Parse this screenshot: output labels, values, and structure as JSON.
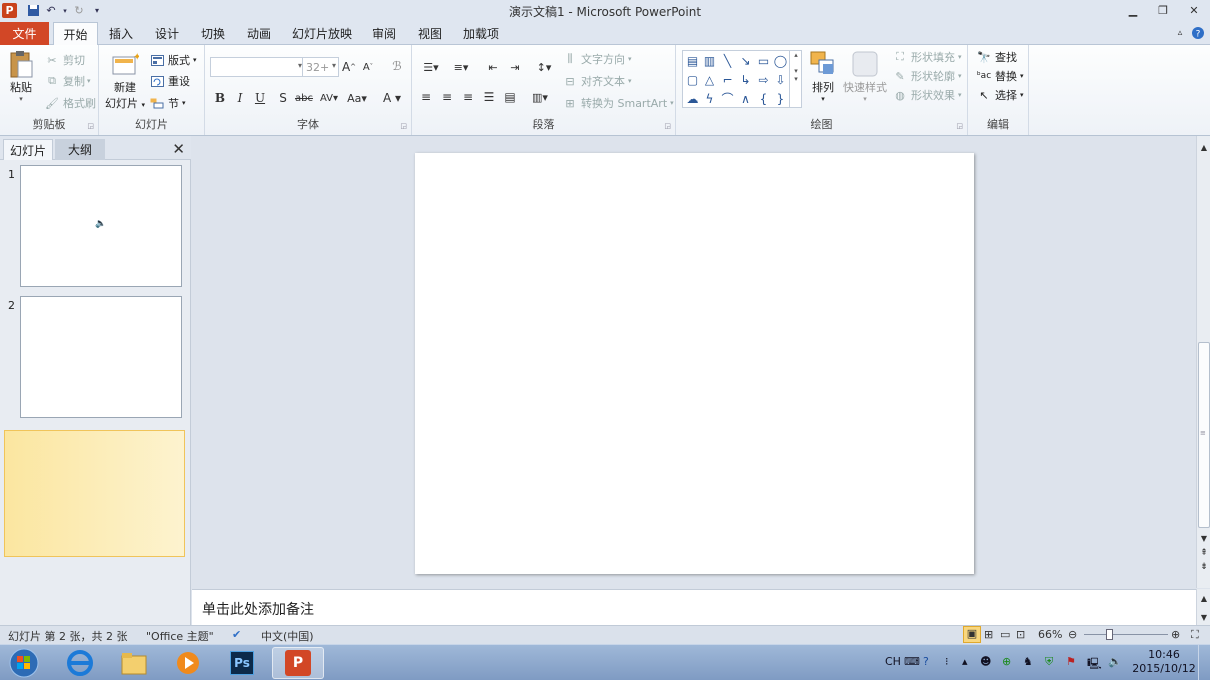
{
  "window": {
    "title": "演示文稿1 - Microsoft PowerPoint"
  },
  "ribbon_tabs": [
    "文件",
    "开始",
    "插入",
    "设计",
    "切换",
    "动画",
    "幻灯片放映",
    "审阅",
    "视图",
    "加载项"
  ],
  "clipboard": {
    "paste": "粘贴",
    "cut": "剪切",
    "copy": "复制",
    "format_painter": "格式刷",
    "label": "剪贴板"
  },
  "slides_group": {
    "new_slide_1": "新建",
    "new_slide_2": "幻灯片",
    "layout": "版式",
    "reset": "重设",
    "section": "节",
    "label": "幻灯片"
  },
  "font": {
    "font_name": "",
    "font_size": "32+",
    "label": "字体"
  },
  "paragraph": {
    "text_direction": "文字方向",
    "align_text": "对齐文本",
    "smartart": "转换为 SmartArt",
    "label": "段落"
  },
  "drawing": {
    "arrange": "排列",
    "quick_styles": "快速样式",
    "shape_fill": "形状填充",
    "shape_outline": "形状轮廓",
    "shape_effects": "形状效果",
    "label": "绘图"
  },
  "editing": {
    "find": "查找",
    "replace": "替换",
    "select": "选择",
    "label": "编辑"
  },
  "panel": {
    "tab_slides": "幻灯片",
    "tab_outline": "大纲",
    "thumbs": [
      {
        "num": "1"
      },
      {
        "num": "2"
      }
    ]
  },
  "notes": {
    "placeholder": "单击此处添加备注"
  },
  "status": {
    "slide_info": "幻灯片 第 2 张，共 2 张",
    "theme": "\"Office 主题\"",
    "language": "中文(中国)",
    "zoom": "66%"
  },
  "taskbar": {
    "ime": "CH",
    "time": "10:46",
    "date": "2015/10/12"
  },
  "colors": {
    "accent": "#d24726",
    "ribbon": "#dfe6f0",
    "selection": "#fbe6a0"
  }
}
